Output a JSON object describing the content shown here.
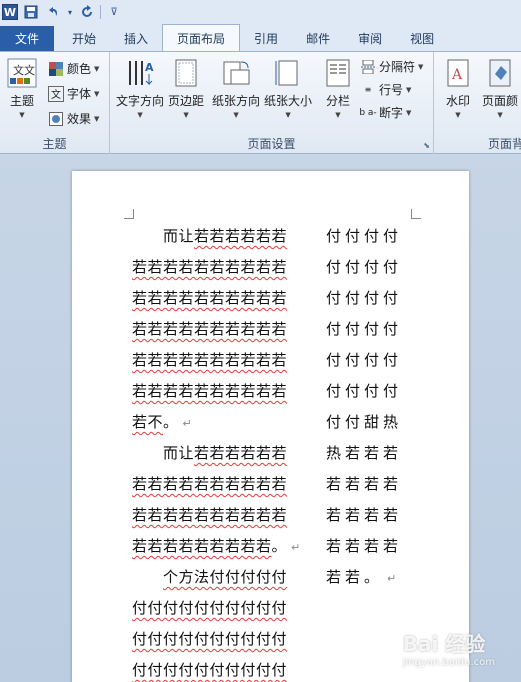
{
  "app": {
    "logo": "W"
  },
  "quick_access": {
    "items": [
      "save",
      "undo",
      "redo",
      "customize"
    ]
  },
  "tabs": [
    "文件",
    "开始",
    "插入",
    "页面布局",
    "引用",
    "邮件",
    "审阅",
    "视图"
  ],
  "active_tab": "页面布局",
  "ribbon": {
    "theme_group": {
      "label": "主题",
      "big_button": "主题",
      "small_buttons": [
        "颜色",
        "字体",
        "效果"
      ]
    },
    "page_setup_group": {
      "label": "页面设置",
      "big_buttons": [
        "文字方向",
        "页边距",
        "纸张方向",
        "纸张大小",
        "分栏"
      ],
      "small_buttons": [
        "分隔符",
        "行号",
        "断字"
      ]
    },
    "page_background_group": {
      "label": "页面背",
      "big_buttons": [
        "水印",
        "页面颜"
      ]
    }
  },
  "document": {
    "left_column": [
      [
        {
          "t": "　　而让",
          "u": false
        },
        {
          "t": "若若若若若若",
          "u": true
        }
      ],
      [
        {
          "t": "若若若若若若若若若若",
          "u": true
        }
      ],
      [
        {
          "t": "若若若若若若若若若若",
          "u": true
        }
      ],
      [
        {
          "t": "若若若若若若若若若若",
          "u": true
        }
      ],
      [
        {
          "t": "若若若若若若若若若若",
          "u": true
        }
      ],
      [
        {
          "t": "若若若若若若若若若若",
          "u": true
        }
      ],
      [
        {
          "t": "若不",
          "u": true
        },
        {
          "t": "。",
          "u": false
        },
        {
          "t": "↵",
          "u": false,
          "p": true
        }
      ],
      [
        {
          "t": "　　而让",
          "u": false
        },
        {
          "t": "若若若若若若",
          "u": true
        }
      ],
      [
        {
          "t": "若若若若若若若若若若",
          "u": true
        }
      ],
      [
        {
          "t": "若若若若若若若若若若",
          "u": true
        }
      ],
      [
        {
          "t": "若若若若若若若若若",
          "u": true
        },
        {
          "t": "。",
          "u": false
        },
        {
          "t": "↵",
          "u": false,
          "p": true
        }
      ],
      [
        {
          "t": "　　",
          "u": false
        },
        {
          "t": "个方法付付付付付",
          "u": true
        }
      ],
      [
        {
          "t": "付付付付付付付付付付",
          "u": true
        }
      ],
      [
        {
          "t": "付付付付付付付付付付",
          "u": true
        }
      ],
      [
        {
          "t": "付付付付付付付付付付",
          "u": true
        }
      ]
    ],
    "right_column": [
      [
        {
          "t": "付付付付",
          "u": false
        }
      ],
      [
        {
          "t": "付付付付",
          "u": false
        }
      ],
      [
        {
          "t": "付付付付",
          "u": false
        }
      ],
      [
        {
          "t": "付付付付",
          "u": false
        }
      ],
      [
        {
          "t": "付付付付",
          "u": false
        }
      ],
      [
        {
          "t": "付付付付",
          "u": false
        }
      ],
      [
        {
          "t": "付付甜热",
          "u": false
        }
      ],
      [
        {
          "t": "热若若若",
          "u": false
        }
      ],
      [
        {
          "t": "若若若若",
          "u": false
        }
      ],
      [
        {
          "t": "若若若若",
          "u": false
        }
      ],
      [
        {
          "t": "若若若若",
          "u": false
        }
      ],
      [
        {
          "t": "若若",
          "u": false
        },
        {
          "t": "。",
          "u": false
        },
        {
          "t": "↵",
          "u": false,
          "p": true
        }
      ]
    ]
  },
  "watermark": {
    "text": "Bai 经验",
    "sub": "jingyan.baidu.com"
  },
  "colors": {
    "file_tab": "#2a5ea8",
    "ribbon_bg": "#f5f8fc",
    "doc_bg": "#c7d5e6",
    "spell_underline": "#e23b3b"
  }
}
